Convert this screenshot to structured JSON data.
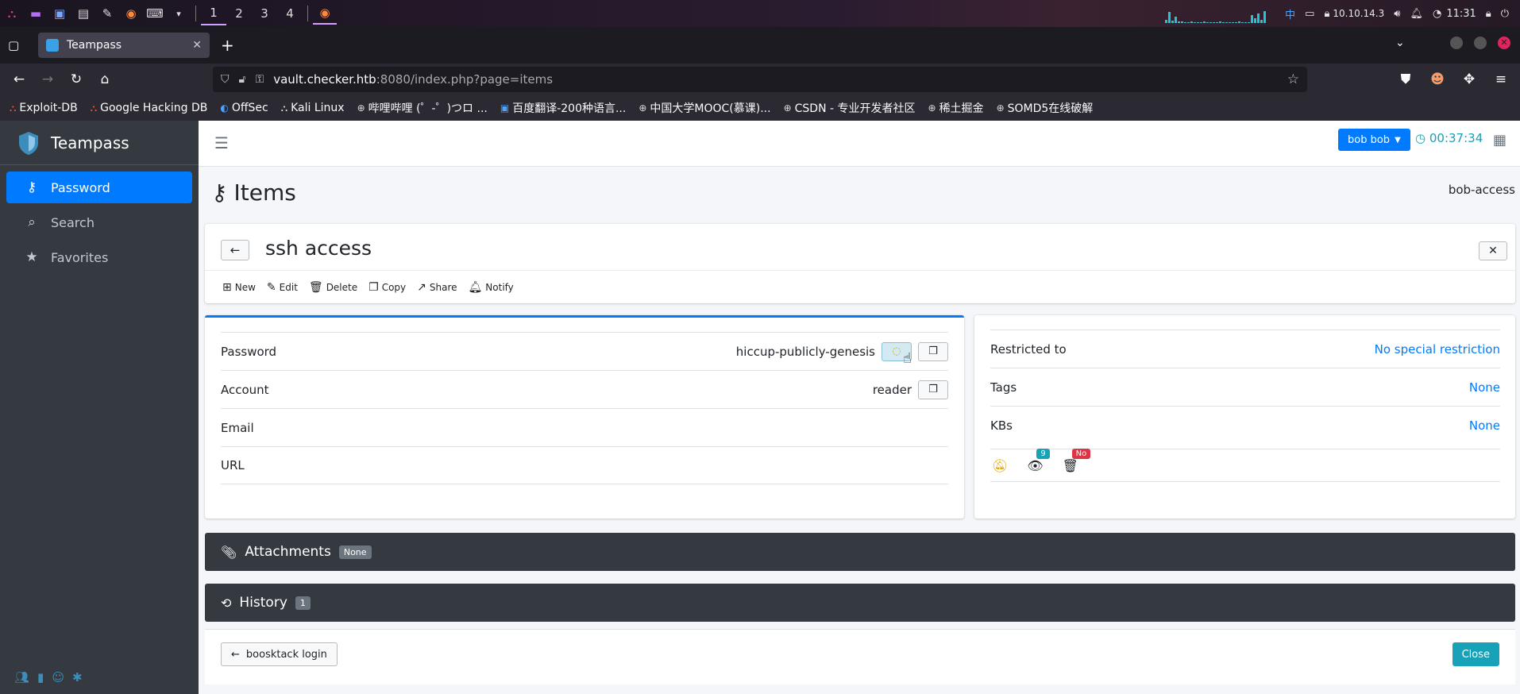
{
  "os_panel": {
    "workspaces": [
      "1",
      "2",
      "3",
      "4"
    ],
    "ime": "中",
    "ip": "10.10.14.3",
    "clock": "11:31",
    "accent_color": "#1fc6d6"
  },
  "browser": {
    "tab_title": "Teampass",
    "url_host": "vault.checker.htb",
    "url_rest": ":8080/index.php?page=items",
    "bookmarks": [
      "Exploit-DB",
      "Google Hacking DB",
      "OffSec",
      "Kali Linux",
      "哔哩哔哩 (゜-゜)つロ ...",
      "百度翻译-200种语言...",
      "中国大学MOOC(慕课)...",
      "CSDN - 专业开发者社区",
      "稀土掘金",
      "SOMD5在线破解"
    ]
  },
  "sidebar": {
    "brand": "Teampass",
    "items": [
      {
        "label": "Password",
        "icon": "key-icon",
        "active": true
      },
      {
        "label": "Search",
        "icon": "search-icon",
        "active": false
      },
      {
        "label": "Favorites",
        "icon": "star-icon",
        "active": false
      }
    ]
  },
  "topnav": {
    "user": "bob bob",
    "timer": "00:37:34"
  },
  "page": {
    "title": "Items",
    "folder": "bob-access"
  },
  "item": {
    "title": "ssh access",
    "toolbar": {
      "new": "New",
      "edit": "Edit",
      "delete": "Delete",
      "copy": "Copy",
      "share": "Share",
      "notify": "Notify"
    },
    "fields": {
      "password_label": "Password",
      "password_value": "hiccup-publicly-genesis",
      "account_label": "Account",
      "account_value": "reader",
      "email_label": "Email",
      "url_label": "URL"
    },
    "details": {
      "restricted_label": "Restricted to",
      "restricted_value": "No special restriction",
      "tags_label": "Tags",
      "tags_value": "None",
      "kbs_label": "KBs",
      "kbs_value": "None",
      "views_badge": "9",
      "delete_badge": "No"
    },
    "attachments": {
      "label": "Attachments",
      "badge": "None"
    },
    "history": {
      "label": "History",
      "badge": "1"
    },
    "footer": {
      "previous": "boosktack login",
      "close": "Close"
    }
  },
  "colors": {
    "primary": "#007bff",
    "info": "#17a2b8",
    "sidebar": "#343a40",
    "danger": "#dc3545"
  }
}
